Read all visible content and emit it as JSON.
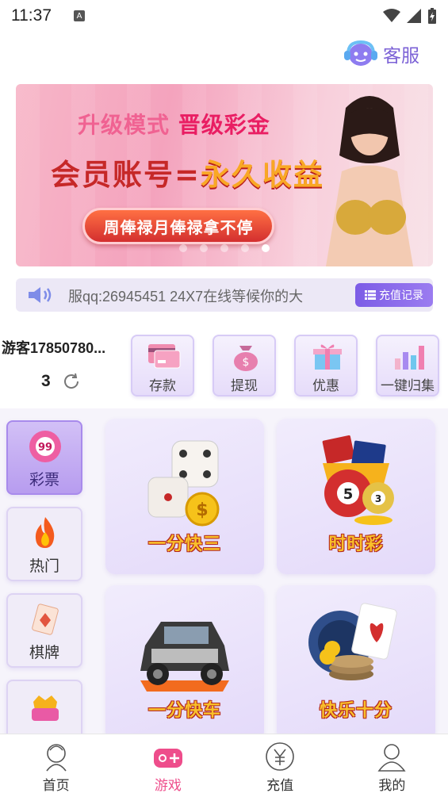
{
  "status_bar": {
    "time": "11:37",
    "notification_icon": "A"
  },
  "header": {
    "service_label": "客服"
  },
  "banner": {
    "line1_a": "升级模式",
    "line1_b": "晋级彩金",
    "line2_a": "会员账号=",
    "line2_b": "永久收益",
    "pill_text": "周俸禄月俸禄拿不停",
    "dots_total": 5,
    "dots_active": 4
  },
  "notice": {
    "text": "服qq:26945451   24X7在线等候你的大",
    "record_button": "充值记录"
  },
  "user": {
    "name": "游客17850780...",
    "balance": "3"
  },
  "actions": [
    {
      "label": "存款",
      "icon": "card-icon"
    },
    {
      "label": "提现",
      "icon": "money-bag-icon"
    },
    {
      "label": "优惠",
      "icon": "gift-icon"
    },
    {
      "label": "一键归集",
      "icon": "bar-chart-icon"
    }
  ],
  "categories": [
    {
      "label": "彩票",
      "icon": "lottery-ball-icon",
      "active": true
    },
    {
      "label": "热门",
      "icon": "fire-icon",
      "active": false
    },
    {
      "label": "棋牌",
      "icon": "playing-card-icon",
      "active": false
    },
    {
      "label": "",
      "icon": "crown-game-icon",
      "active": false
    }
  ],
  "games": [
    {
      "name": "一分快三",
      "icon": "dice-icon"
    },
    {
      "name": "时时彩",
      "icon": "lottery-balls-icon"
    },
    {
      "name": "一分快车",
      "icon": "race-car-icon"
    },
    {
      "name": "快乐十分",
      "icon": "poker-chips-icon"
    }
  ],
  "tabs": [
    {
      "label": "首页",
      "icon": "home-icon",
      "active": false
    },
    {
      "label": "游戏",
      "icon": "gamepad-icon",
      "active": true
    },
    {
      "label": "充值",
      "icon": "yuan-icon",
      "active": false
    },
    {
      "label": "我的",
      "icon": "user-icon",
      "active": false
    }
  ],
  "colors": {
    "accent": "#7b61d6",
    "tab_active": "#ee4d8b",
    "category_active": "#b79cef"
  }
}
